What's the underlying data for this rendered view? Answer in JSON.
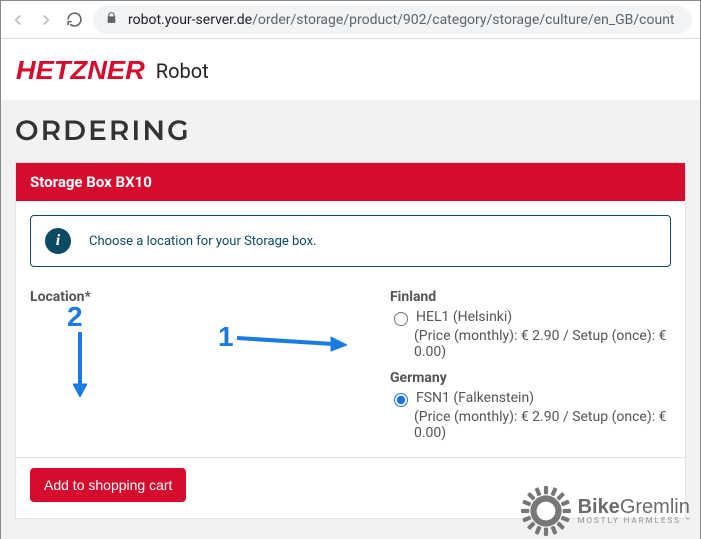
{
  "browser": {
    "url_host": "robot.your-server.de",
    "url_path": "/order/storage/product/902/category/storage/culture/en_GB/count"
  },
  "header": {
    "logo": "HETZNER",
    "product": "Robot"
  },
  "page": {
    "title": "ORDERING"
  },
  "card": {
    "title": "Storage Box BX10",
    "info": "Choose a location for your Storage box.",
    "location_label": "Location*"
  },
  "locations": {
    "finland": {
      "country": "Finland",
      "option_label": "HEL1 (Helsinki)",
      "price": "(Price (monthly): € 2.90 / Setup (once): € 0.00)"
    },
    "germany": {
      "country": "Germany",
      "option_label": "FSN1 (Falkenstein)",
      "price": "(Price (monthly): € 2.90 / Setup (once): € 0.00)"
    }
  },
  "actions": {
    "add_to_cart": "Add to shopping cart"
  },
  "annotations": {
    "one": "1",
    "two": "2"
  },
  "watermark": {
    "title_bold": "Bike",
    "title_rest": "Gremlin",
    "subtitle": "MOSTLY HARMLESS ™"
  }
}
